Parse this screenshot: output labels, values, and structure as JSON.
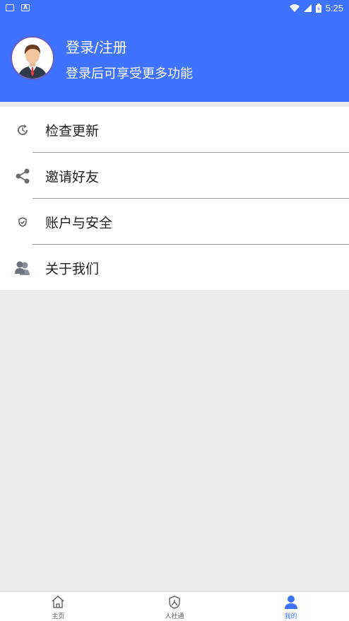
{
  "status_bar": {
    "time": "5:25"
  },
  "header": {
    "login_title": "登录/注册",
    "login_subtitle": "登录后可享受更多功能"
  },
  "menu": {
    "items": [
      {
        "label": "检查更新",
        "icon": "refresh-icon"
      },
      {
        "label": "邀请好友",
        "icon": "share-icon"
      },
      {
        "label": "账户与安全",
        "icon": "shield-icon"
      },
      {
        "label": "关于我们",
        "icon": "users-icon"
      }
    ]
  },
  "bottom_nav": {
    "items": [
      {
        "label": "主页",
        "icon": "home-icon",
        "active": false
      },
      {
        "label": "人社通",
        "icon": "shield-person-icon",
        "active": false
      },
      {
        "label": "我的",
        "icon": "person-icon",
        "active": true
      }
    ]
  },
  "colors": {
    "accent": "#3f72ff",
    "background": "#ebebeb"
  }
}
